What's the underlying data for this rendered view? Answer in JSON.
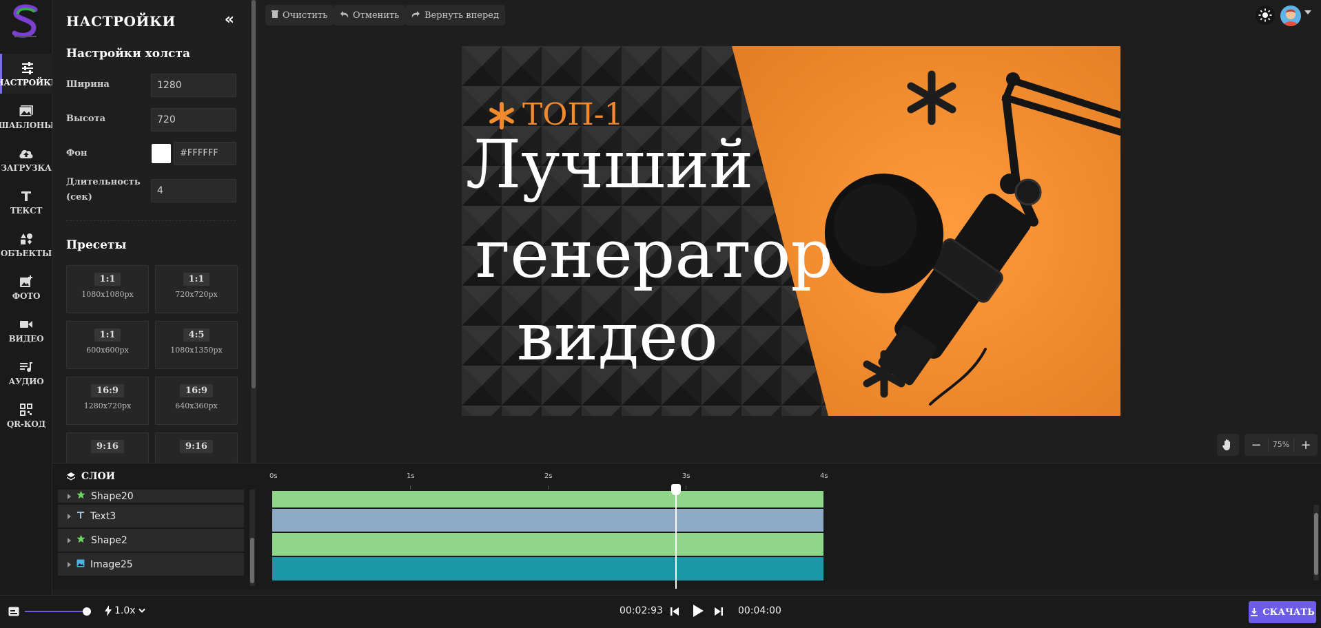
{
  "sidebar": {
    "items": [
      {
        "label": "НАСТРОЙКИ",
        "icon": "sliders-icon",
        "active": true
      },
      {
        "label": "ШАБЛОНЫ",
        "icon": "images-icon"
      },
      {
        "label": "ЗАГРУЗКА",
        "icon": "cloud-upload-icon"
      },
      {
        "label": "ТЕКСТ",
        "icon": "text-icon"
      },
      {
        "label": "ОБЪЕКТЫ",
        "icon": "shapes-icon"
      },
      {
        "label": "ФОТО",
        "icon": "add-photo-icon"
      },
      {
        "label": "ВИДЕО",
        "icon": "video-camera-icon"
      },
      {
        "label": "АУДИО",
        "icon": "audio-icon"
      },
      {
        "label": "QR-КОД",
        "icon": "qr-code-icon"
      }
    ]
  },
  "panel": {
    "title": "НАСТРОЙКИ",
    "canvas_section": "Настройки холста",
    "width_label": "Ширина",
    "width_value": "1280",
    "height_label": "Высота",
    "height_value": "720",
    "bg_label": "Фон",
    "bg_value": "#FFFFFF",
    "duration_label": "Длительность (сек)",
    "duration_value": "4",
    "presets_title": "Пресеты",
    "presets": [
      {
        "ratio": "1:1",
        "dims": "1080x1080px"
      },
      {
        "ratio": "1:1",
        "dims": "720x720px"
      },
      {
        "ratio": "1:1",
        "dims": "600x600px"
      },
      {
        "ratio": "4:5",
        "dims": "1080x1350px"
      },
      {
        "ratio": "16:9",
        "dims": "1280x720px"
      },
      {
        "ratio": "16:9",
        "dims": "640x360px"
      },
      {
        "ratio": "9:16",
        "dims": ""
      },
      {
        "ratio": "9:16",
        "dims": ""
      }
    ]
  },
  "toolbar": {
    "clear_label": "Очистить",
    "undo_label": "Отменить",
    "redo_label": "Вернуть вперед"
  },
  "canvas": {
    "badge": "ТОП-1",
    "line1": "Лучший",
    "line2": "генератор",
    "line3": "видео",
    "colors": {
      "orange": "#F28A2E",
      "dark": "#2b2b2b",
      "text": "#FFFFFF"
    }
  },
  "zoom": {
    "value": "75%",
    "minus": "−",
    "plus": "+"
  },
  "timeline": {
    "layers_title": "СЛОИ",
    "ruler": [
      "0s",
      "1s",
      "2s",
      "3s",
      "4s"
    ],
    "layers": [
      {
        "name": "Shape20",
        "icon": "star-icon",
        "color": "#8fd68a"
      },
      {
        "name": "Text3",
        "icon": "text-type-icon",
        "color": "#8faac5"
      },
      {
        "name": "Shape2",
        "icon": "star-icon",
        "color": "#8fd68a"
      },
      {
        "name": "Image25",
        "icon": "image-icon",
        "color": "#1a98a8"
      }
    ],
    "playhead_seconds": 2.93,
    "duration_seconds": 4
  },
  "playback": {
    "speed": "1.0x",
    "current_time": "00:02:93",
    "total_time": "00:04:00",
    "download_label": "СКАЧАТЬ"
  }
}
